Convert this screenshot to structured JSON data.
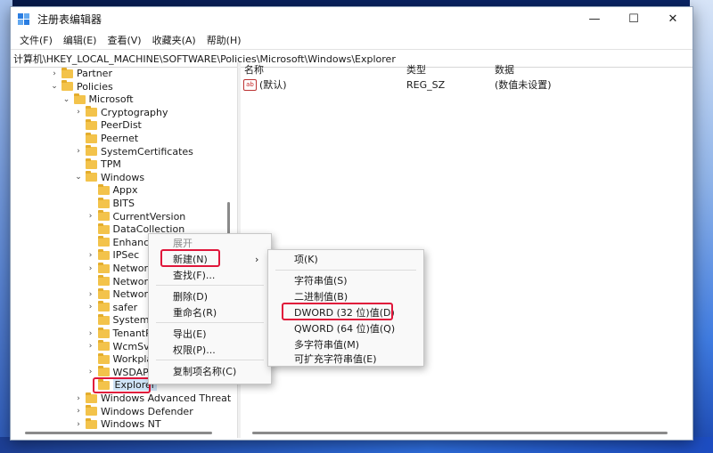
{
  "window": {
    "title": "注册表编辑器",
    "controls": {
      "minimize": "—",
      "maximize": "☐",
      "close": "✕"
    }
  },
  "menubar": [
    "文件(F)",
    "编辑(E)",
    "查看(V)",
    "收藏夹(A)",
    "帮助(H)"
  ],
  "address": "计算机\\HKEY_LOCAL_MACHINE\\SOFTWARE\\Policies\\Microsoft\\Windows\\Explorer",
  "tree": [
    {
      "label": "Partner",
      "depth": 1,
      "expander": "›"
    },
    {
      "label": "Policies",
      "depth": 1,
      "expander": "⌄"
    },
    {
      "label": "Microsoft",
      "depth": 2,
      "expander": "⌄"
    },
    {
      "label": "Cryptography",
      "depth": 3,
      "expander": "›"
    },
    {
      "label": "PeerDist",
      "depth": 3,
      "expander": ""
    },
    {
      "label": "Peernet",
      "depth": 3,
      "expander": ""
    },
    {
      "label": "SystemCertificates",
      "depth": 3,
      "expander": "›"
    },
    {
      "label": "TPM",
      "depth": 3,
      "expander": ""
    },
    {
      "label": "Windows",
      "depth": 3,
      "expander": "⌄"
    },
    {
      "label": "Appx",
      "depth": 4,
      "expander": ""
    },
    {
      "label": "BITS",
      "depth": 4,
      "expander": ""
    },
    {
      "label": "CurrentVersion",
      "depth": 4,
      "expander": "›"
    },
    {
      "label": "DataCollection",
      "depth": 4,
      "expander": ""
    },
    {
      "label": "EnhancedStorageDevices",
      "depth": 4,
      "expander": ""
    },
    {
      "label": "IPSec",
      "depth": 4,
      "expander": "›"
    },
    {
      "label": "Network Connections",
      "depth": 4,
      "expander": "›"
    },
    {
      "label": "NetworkConnectivityStatusIndicator",
      "depth": 4,
      "expander": ""
    },
    {
      "label": "NetworkProvider",
      "depth": 4,
      "expander": "›"
    },
    {
      "label": "safer",
      "depth": 4,
      "expander": "›"
    },
    {
      "label": "System",
      "depth": 4,
      "expander": ""
    },
    {
      "label": "TenantRestrictions",
      "depth": 4,
      "expander": "›"
    },
    {
      "label": "WcmSvc",
      "depth": 4,
      "expander": "›"
    },
    {
      "label": "WorkplaceJoin",
      "depth": 4,
      "expander": ""
    },
    {
      "label": "WSDAPI",
      "depth": 4,
      "expander": "›"
    },
    {
      "label": "Explorer",
      "depth": 4,
      "expander": "",
      "selected": true
    },
    {
      "label": "Windows Advanced Threat Protection",
      "depth": 3,
      "expander": "›"
    },
    {
      "label": "Windows Defender",
      "depth": 3,
      "expander": "›"
    },
    {
      "label": "Windows NT",
      "depth": 3,
      "expander": "›"
    }
  ],
  "list": {
    "headers": {
      "name": "名称",
      "type": "类型",
      "data": "数据"
    },
    "rows": [
      {
        "icon": "ab",
        "name": "(默认)",
        "type": "REG_SZ",
        "data": "(数值未设置)"
      }
    ]
  },
  "context_menu": {
    "items": [
      {
        "label": "展开",
        "disabled": true
      },
      {
        "label": "新建(N)",
        "submenu": true,
        "arrow": "›",
        "highlight": true
      },
      {
        "label": "查找(F)..."
      },
      {
        "sep": true
      },
      {
        "label": "删除(D)"
      },
      {
        "label": "重命名(R)"
      },
      {
        "sep": true
      },
      {
        "label": "导出(E)"
      },
      {
        "label": "权限(P)..."
      },
      {
        "sep": true
      },
      {
        "label": "复制项名称(C)"
      }
    ]
  },
  "new_submenu": {
    "items": [
      {
        "label": "项(K)"
      },
      {
        "sep": true
      },
      {
        "label": "字符串值(S)"
      },
      {
        "label": "二进制值(B)"
      },
      {
        "label": "DWORD (32 位)值(D)",
        "highlight": true
      },
      {
        "label": "QWORD (64 位)值(Q)"
      },
      {
        "label": "多字符串值(M)"
      },
      {
        "label": "可扩充字符串值(E)"
      }
    ]
  },
  "colors": {
    "highlight_box": "#e0163a",
    "folder": "#f3c34b",
    "selected_bg": "#cfe3f7"
  }
}
